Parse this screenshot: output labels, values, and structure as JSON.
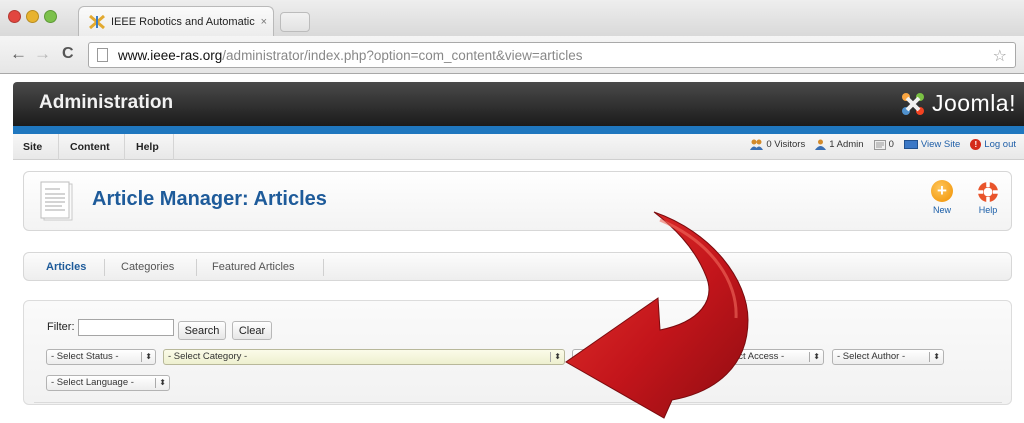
{
  "browser": {
    "tab_title": "IEEE Robotics and Automatic",
    "tab_close": "×",
    "url_host": "www.ieee-ras.org",
    "url_path": "/administrator/index.php?option=com_content&view=articles",
    "back_glyph": "←",
    "forward_glyph": "→",
    "reload_glyph": "C",
    "star_glyph": "☆"
  },
  "header": {
    "title": "Administration",
    "logo_text": "Joomla!"
  },
  "menu": {
    "items": [
      "Site",
      "Content",
      "Help"
    ]
  },
  "status": {
    "visitors": "0 Visitors",
    "admins": "1 Admin",
    "messages": "0",
    "view_site": "View Site",
    "logout": "Log out"
  },
  "toolbar": {
    "page_title": "Article Manager: Articles",
    "new_label": "New",
    "new_glyph": "+",
    "help_label": "Help"
  },
  "subnav": {
    "tabs": [
      "Articles",
      "Categories",
      "Featured Articles"
    ],
    "active": "Articles"
  },
  "filters": {
    "filter_label": "Filter:",
    "filter_value": "",
    "search_button": "Search",
    "clear_button": "Clear",
    "select_status": "- Select Status -",
    "select_category": "- Select Category -",
    "select_access": "ect Access -",
    "select_author": "- Select Author -",
    "select_language": "- Select Language -",
    "select_arrow": "⬍"
  },
  "colors": {
    "accent_blue": "#1f77bf",
    "title_blue": "#1e5b9a",
    "arrow_red": "#c8191e"
  },
  "icons": [
    "favicon-icon",
    "page-icon",
    "star-icon",
    "joomla-logo-icon",
    "visitors-icon",
    "admin-icon",
    "messages-icon",
    "view-site-icon",
    "logout-icon",
    "article-icon",
    "new-icon",
    "help-icon",
    "red-arrow-annotation"
  ]
}
